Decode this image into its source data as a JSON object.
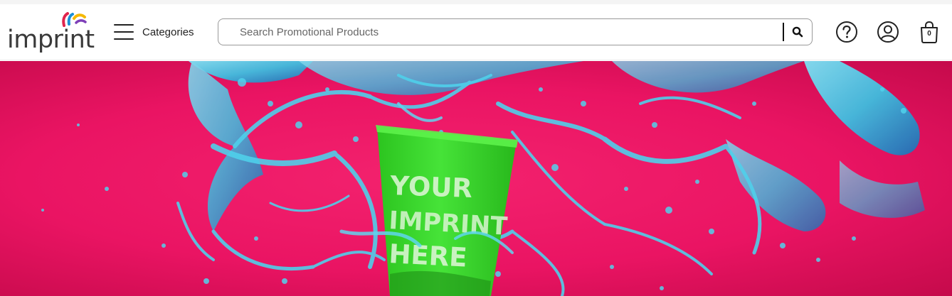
{
  "brand": {
    "logo_text": "imprint",
    "logo_colors": [
      "#e0244d",
      "#1a8fd6",
      "#f5b800",
      "#7e3fb8"
    ]
  },
  "nav": {
    "categories_label": "Categories",
    "menu_icon": "hamburger-menu-icon"
  },
  "search": {
    "placeholder": "Search Promotional Products",
    "value": "",
    "icon": "search-icon"
  },
  "actions": {
    "help_icon": "question-circle-icon",
    "account_icon": "user-circle-icon",
    "cart_icon": "shopping-bag-icon",
    "cart_count": "0"
  },
  "hero": {
    "background_color": "#ea1463",
    "splash_color": "#45c7e3",
    "cup_color": "#3ed92e",
    "cup_text_lines": [
      "YOUR",
      "IMPRINT",
      "HERE"
    ]
  }
}
